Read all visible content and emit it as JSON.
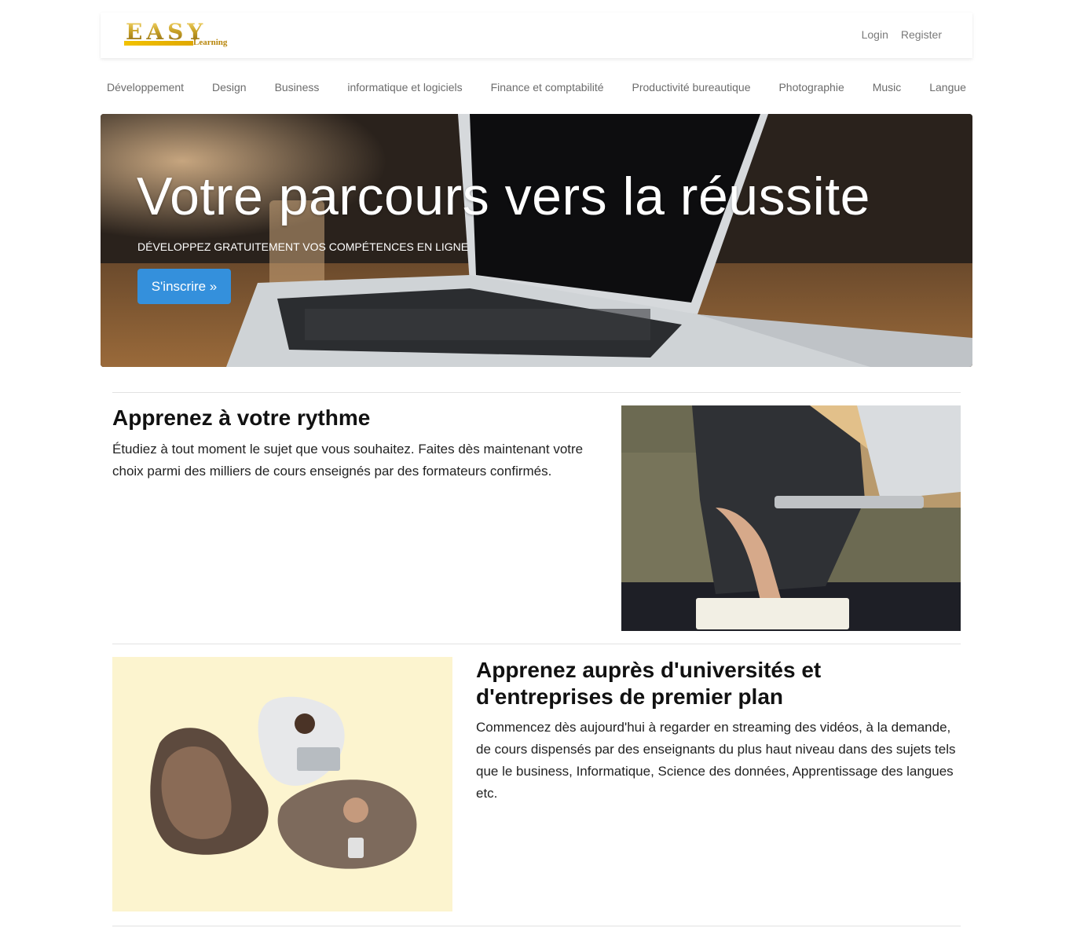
{
  "header": {
    "logo": {
      "main": "EASY",
      "sub": "Learning"
    },
    "auth": {
      "login": "Login",
      "register": "Register"
    }
  },
  "categories": [
    "Développement",
    "Design",
    "Business",
    "informatique et logiciels",
    "Finance et comptabilité",
    "Productivité bureautique",
    "Photographie",
    "Music",
    "Langue"
  ],
  "hero": {
    "title": "Votre parcours vers la réussite",
    "subtitle": "DÉVELOPPEZ GRATUITEMENT VOS COMPÉTENCES EN LIGNE",
    "cta": "S'inscrire »"
  },
  "features": [
    {
      "title": "Apprenez à votre rythme",
      "text": "Étudiez à tout moment le sujet que vous souhaitez. Faites dès maintenant votre choix parmi des milliers de cours enseignés par des formateurs confirmés."
    },
    {
      "title": "Apprenez auprès d'universités et d'entreprises de premier plan",
      "text": "Commencez dès aujourd'hui à regarder en streaming des vidéos, à la demande, de cours dispensés par des enseignants du plus haut niveau dans des sujets tels que le business, Informatique, Science des données, Apprentissage des langues etc."
    }
  ],
  "colors": {
    "primary_button": "#3490dc",
    "logo_gold": "#c9a227",
    "blob_background": "#fcf4cf"
  }
}
